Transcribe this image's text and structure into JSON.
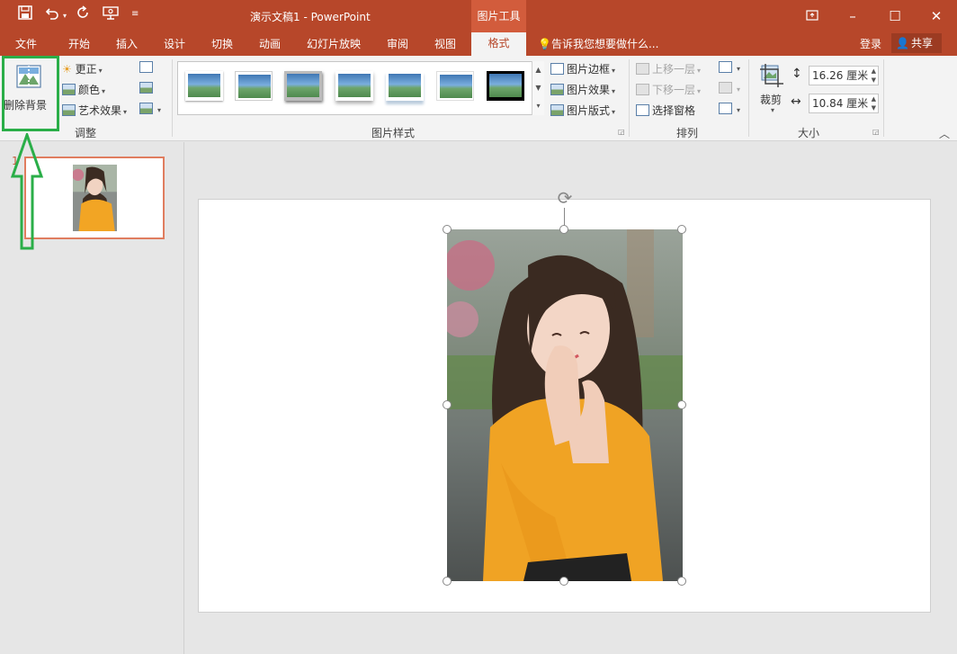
{
  "titlebar": {
    "doc_title": "演示文稿1 - PowerPoint",
    "context_tab": "图片工具",
    "qat": [
      "save-icon",
      "undo-icon",
      "redo-icon",
      "present-icon",
      "customize-icon"
    ]
  },
  "tabs": {
    "file": "文件",
    "home": "开始",
    "insert": "插入",
    "design": "设计",
    "transitions": "切换",
    "animations": "动画",
    "slideshow": "幻灯片放映",
    "review": "审阅",
    "view": "视图",
    "format": "格式",
    "tell_me": "告诉我您想要做什么...",
    "login": "登录",
    "share": "共享"
  },
  "ribbon": {
    "remove_bg": "删除背景",
    "corrections": "更正",
    "color": "颜色",
    "artistic": "艺术效果",
    "adjust_label": "调整",
    "styles_label": "图片样式",
    "border": "图片边框",
    "effects": "图片效果",
    "layout": "图片版式",
    "bring_forward": "上移一层",
    "send_backward": "下移一层",
    "selection_pane": "选择窗格",
    "arrange_label": "排列",
    "crop": "裁剪",
    "height": "16.26 厘米",
    "width": "10.84 厘米",
    "size_label": "大小"
  },
  "slides": {
    "number": "1"
  },
  "colors": {
    "accent": "#b7472a",
    "highlight": "#2aae48"
  }
}
